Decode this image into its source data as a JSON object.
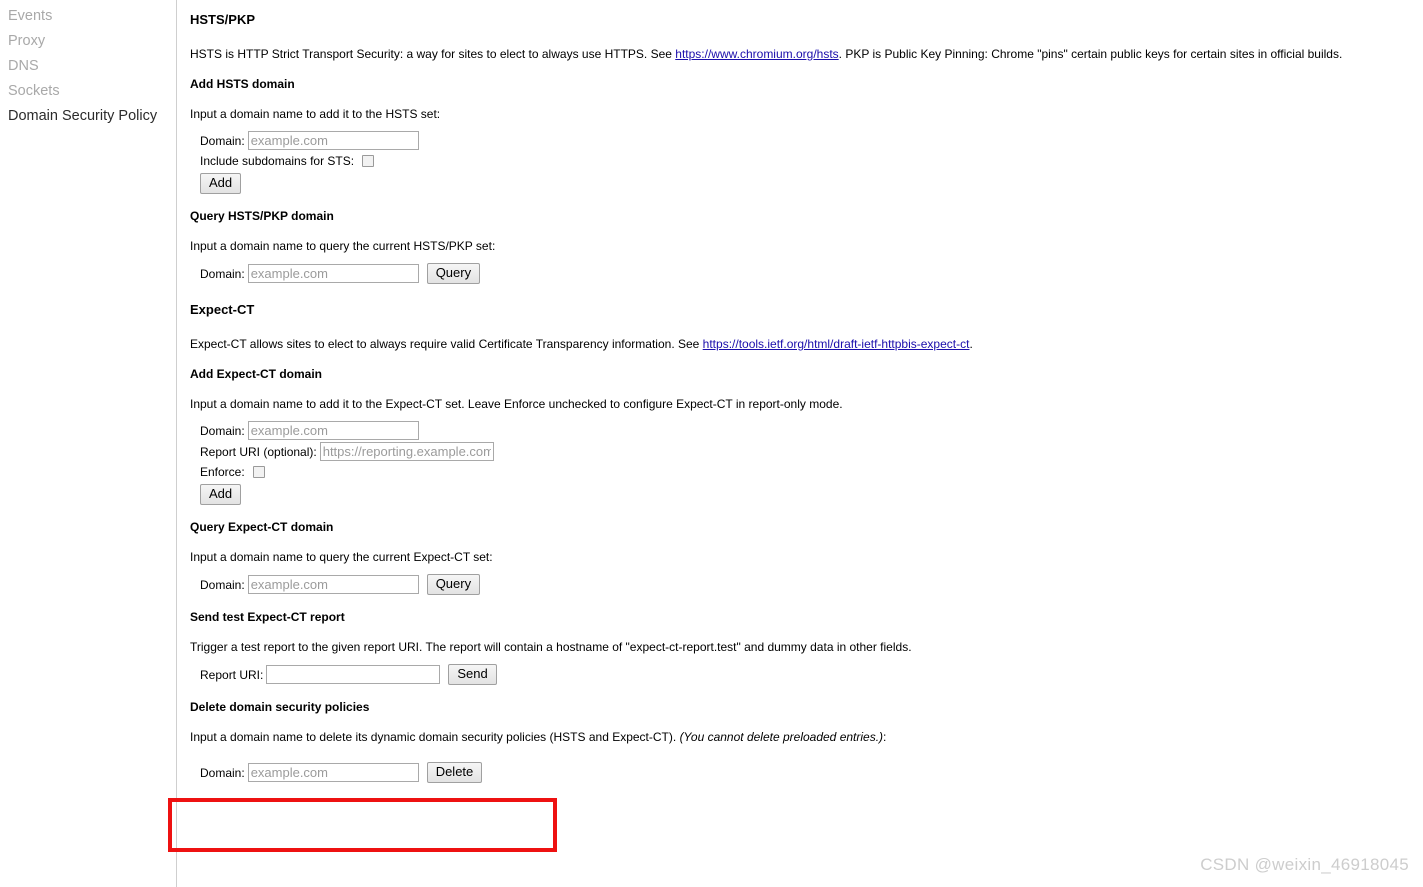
{
  "sidebar": {
    "items": [
      {
        "label": "Events",
        "selected": false
      },
      {
        "label": "Proxy",
        "selected": false
      },
      {
        "label": "DNS",
        "selected": false
      },
      {
        "label": "Sockets",
        "selected": false
      },
      {
        "label": "Domain Security Policy",
        "selected": true
      }
    ]
  },
  "hsts": {
    "title": "HSTS/PKP",
    "description_before_link": "HSTS is HTTP Strict Transport Security: a way for sites to elect to always use HTTPS. See ",
    "link_text": "https://www.chromium.org/hsts",
    "description_after_link": ". PKP is Public Key Pinning: Chrome \"pins\" certain public keys for certain sites in official builds.",
    "add": {
      "title": "Add HSTS domain",
      "instruction": "Input a domain name to add it to the HSTS set:",
      "domain_label": "Domain:",
      "domain_value": "",
      "domain_placeholder": "example.com",
      "subdomains_label": "Include subdomains for STS:",
      "subdomains_checked": false,
      "add_button": "Add"
    },
    "query": {
      "title": "Query HSTS/PKP domain",
      "instruction": "Input a domain name to query the current HSTS/PKP set:",
      "domain_label": "Domain:",
      "domain_value": "",
      "domain_placeholder": "example.com",
      "query_button": "Query"
    }
  },
  "expect_ct": {
    "title": "Expect-CT",
    "description_before_link": "Expect-CT allows sites to elect to always require valid Certificate Transparency information. See ",
    "link_text": "https://tools.ietf.org/html/draft-ietf-httpbis-expect-ct",
    "description_after_link": ".",
    "add": {
      "title": "Add Expect-CT domain",
      "instruction": "Input a domain name to add it to the Expect-CT set. Leave Enforce unchecked to configure Expect-CT in report-only mode.",
      "domain_label": "Domain:",
      "domain_value": "",
      "domain_placeholder": "example.com",
      "report_uri_label": "Report URI (optional):",
      "report_uri_value": "",
      "report_uri_placeholder": "https://reporting.example.com/cb",
      "enforce_label": "Enforce:",
      "enforce_checked": false,
      "add_button": "Add"
    },
    "query": {
      "title": "Query Expect-CT domain",
      "instruction": "Input a domain name to query the current Expect-CT set:",
      "domain_label": "Domain:",
      "domain_value": "",
      "domain_placeholder": "example.com",
      "query_button": "Query"
    },
    "test_report": {
      "title": "Send test Expect-CT report",
      "instruction": "Trigger a test report to the given report URI. The report will contain a hostname of \"expect-ct-report.test\" and dummy data in other fields.",
      "report_uri_label": "Report URI:",
      "report_uri_value": "",
      "report_uri_placeholder": "",
      "send_button": "Send"
    }
  },
  "delete": {
    "title": "Delete domain security policies",
    "instruction_plain": "Input a domain name to delete its dynamic domain security policies (HSTS and Expect-CT). ",
    "instruction_italic": "(You cannot delete preloaded entries.)",
    "instruction_suffix": ":",
    "domain_label": "Domain:",
    "domain_value": "",
    "domain_placeholder": "example.com",
    "delete_button": "Delete"
  },
  "annotation": {
    "highlight_color": "#ee1111"
  },
  "watermark": {
    "text": "CSDN @weixin_46918045"
  }
}
